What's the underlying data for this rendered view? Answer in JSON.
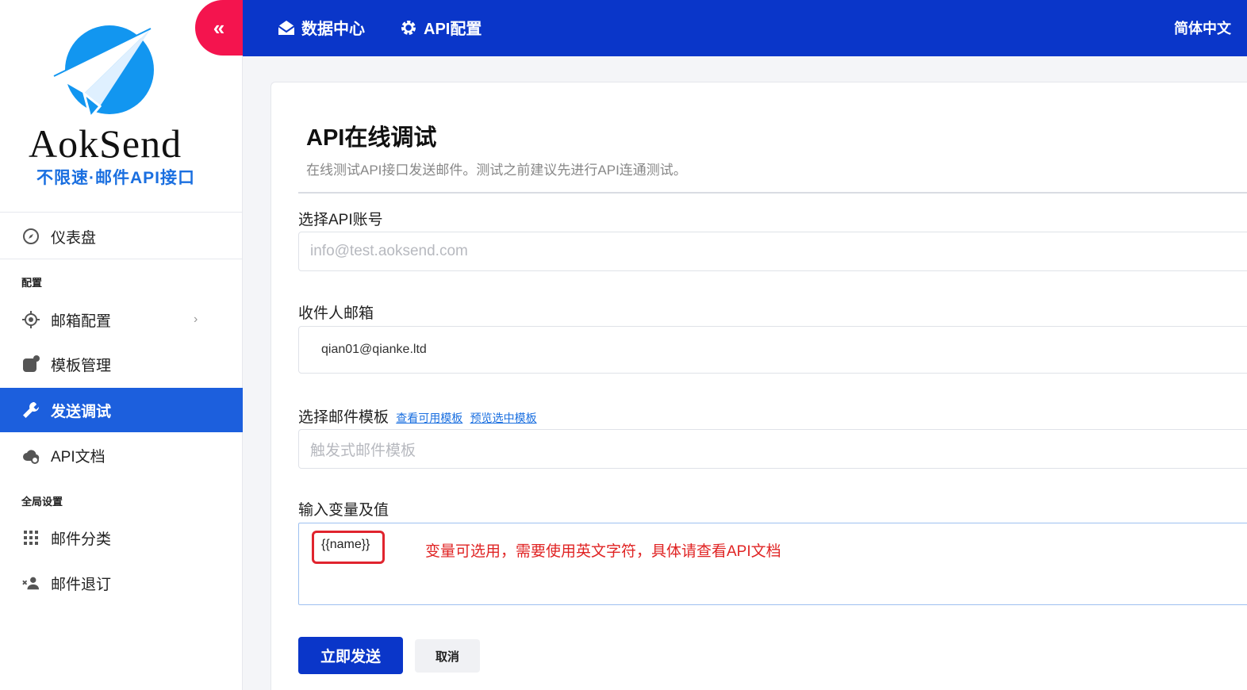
{
  "sidebar": {
    "logo_word": "AokSend",
    "logo_tagline": "不限速·邮件API接口",
    "collapse_glyph": "«",
    "dashboard": "仪表盘",
    "section_config": "配置",
    "mailbox_config": "邮箱配置",
    "template_mgmt": "模板管理",
    "send_test": "发送调试",
    "api_docs": "API文档",
    "section_global": "全局设置",
    "mail_category": "邮件分类",
    "unsubscribe": "邮件退订"
  },
  "topbar": {
    "data_center": "数据中心",
    "api_config": "API配置",
    "language": "简体中文"
  },
  "main": {
    "title": "API在线调试",
    "subtitle": "在线测试API接口发送邮件。测试之前建议先进行API连通测试。",
    "account_label": "选择API账号",
    "account_placeholder": "info@test.aoksend.com",
    "recipient_label": "收件人邮箱",
    "recipient_value": "qian01@qianke.ltd",
    "template_label": "选择邮件模板",
    "view_templates_link": "查看可用模板",
    "preview_template_link": "预览选中模板",
    "template_placeholder": "触发式邮件模板",
    "variables_label": "输入变量及值",
    "variable_token": "{{name}}",
    "variable_note": "变量可选用，需要使用英文字符，具体请查看API文档",
    "send_button": "立即发送",
    "cancel_button": "取消"
  },
  "colors": {
    "brand_blue": "#0a36c9",
    "active_nav": "#1c5fdd",
    "collapse_red": "#f4144e",
    "annotation_red": "#e02424"
  }
}
